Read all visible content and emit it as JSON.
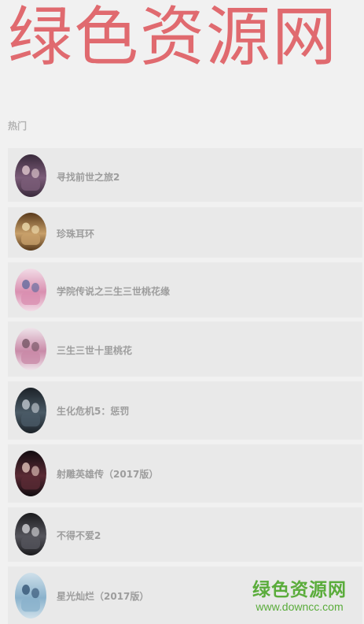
{
  "brand": {
    "text": "绿色资源网"
  },
  "section": {
    "title": "热门"
  },
  "items": [
    {
      "title": "寻找前世之旅2",
      "poster_colors": [
        "#3a2a3c",
        "#7b5c78",
        "#d9c1c8"
      ]
    },
    {
      "title": "珍珠耳环",
      "poster_colors": [
        "#5a3b1c",
        "#c8a06a",
        "#e9d6a8"
      ]
    },
    {
      "title": "学院传说之三生三世桃花缘",
      "poster_colors": [
        "#f2dbe6",
        "#d98fb0",
        "#6a6fa0"
      ]
    },
    {
      "title": "三生三世十里桃花",
      "poster_colors": [
        "#efe3ea",
        "#c98aa8",
        "#7a5a6a"
      ]
    },
    {
      "title": "生化危机5：惩罚",
      "poster_colors": [
        "#1c2228",
        "#4a5a66",
        "#b9c0c8"
      ]
    },
    {
      "title": "射雕英雄传（2017版）",
      "poster_colors": [
        "#120c10",
        "#5a2a34",
        "#d7b8b0"
      ]
    },
    {
      "title": "不得不爱2",
      "poster_colors": [
        "#1b1b1e",
        "#55555c",
        "#c9c9cc"
      ]
    },
    {
      "title": "星光灿烂（2017版）",
      "poster_colors": [
        "#cfe0ea",
        "#8ab2cc",
        "#3a5a7a"
      ]
    }
  ],
  "watermark": {
    "main": "绿色资源网",
    "sub": "www.downcc.com"
  }
}
